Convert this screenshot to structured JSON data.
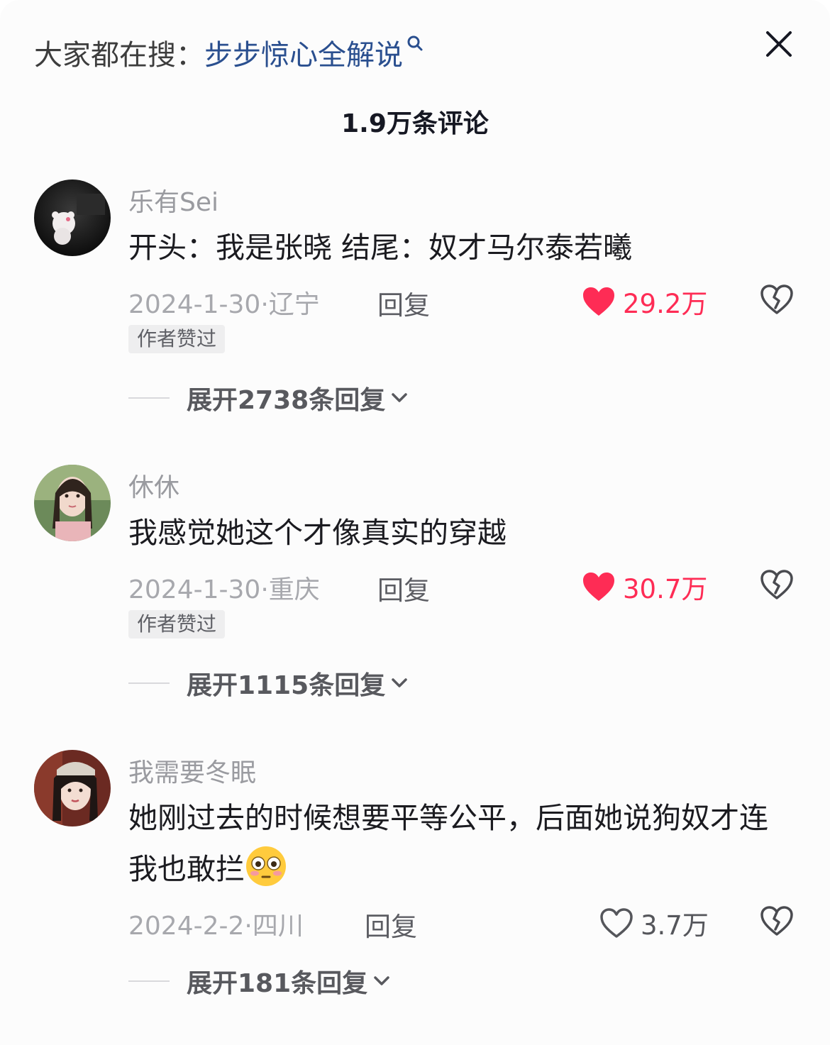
{
  "header": {
    "search_prefix": "大家都在搜：",
    "search_term": "步步惊心全解说",
    "comment_count": "1.9万条评论"
  },
  "colors": {
    "liked_red": "#fe2c55",
    "link_blue": "#2a4f8f"
  },
  "comments": [
    {
      "username": "乐有Sei",
      "text": "开头：我是张晓 结尾：奴才马尔泰若曦",
      "date": "2024-1-30",
      "location": "辽宁",
      "reply_label": "回复",
      "likes": "29.2万",
      "liked": true,
      "author_badge": "作者赞过",
      "expand_label": "展开2738条回复"
    },
    {
      "username": "休休",
      "text": "我感觉她这个才像真实的穿越",
      "date": "2024-1-30",
      "location": "重庆",
      "reply_label": "回复",
      "likes": "30.7万",
      "liked": true,
      "author_badge": "作者赞过",
      "expand_label": "展开1115条回复"
    },
    {
      "username": "我需要冬眠",
      "text": "她刚过去的时候想要平等公平，后面她说狗奴才连我也敢拦",
      "emoji": "flushed-face-emoji",
      "date": "2024-2-2",
      "location": "四川",
      "reply_label": "回复",
      "likes": "3.7万",
      "liked": false,
      "expand_label": "展开181条回复"
    }
  ]
}
